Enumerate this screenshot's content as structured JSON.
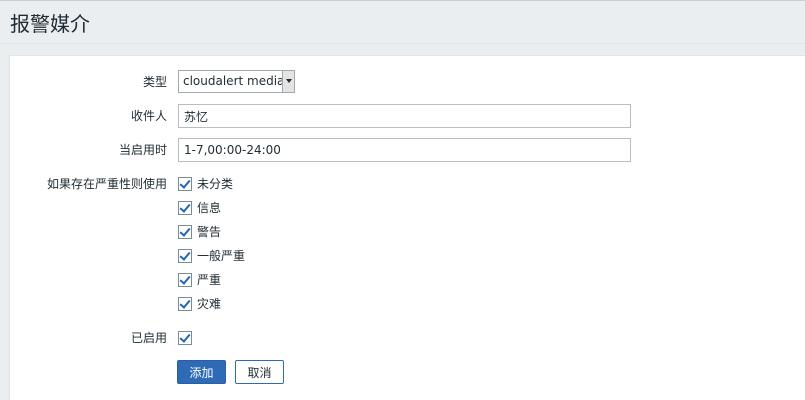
{
  "page": {
    "title": "报警媒介"
  },
  "form": {
    "type": {
      "label": "类型",
      "selected": "cloudalert media"
    },
    "recipient": {
      "label": "收件人",
      "value": "苏忆"
    },
    "when_active": {
      "label": "当启用时",
      "value": "1-7,00:00-24:00"
    },
    "severity": {
      "label": "如果存在严重性则使用",
      "options": [
        {
          "label": "未分类",
          "checked": true
        },
        {
          "label": "信息",
          "checked": true
        },
        {
          "label": "警告",
          "checked": true
        },
        {
          "label": "一般严重",
          "checked": true
        },
        {
          "label": "严重",
          "checked": true
        },
        {
          "label": "灾难",
          "checked": true
        }
      ]
    },
    "enabled": {
      "label": "已启用",
      "checked": true
    },
    "buttons": {
      "add_label": "添加",
      "cancel_label": "取消"
    }
  },
  "colors": {
    "primary": "#2f6ab6",
    "check": "#1f65b8",
    "background": "#ebeef0"
  }
}
